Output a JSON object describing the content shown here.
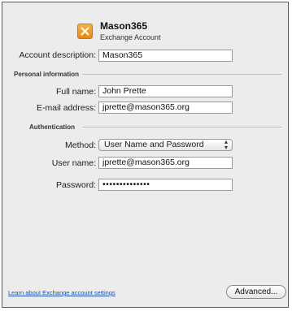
{
  "header": {
    "account_name": "Mason365",
    "account_type": "Exchange Account",
    "icon": "exchange-icon"
  },
  "account": {
    "description_label": "Account description:",
    "description_value": "Mason365"
  },
  "personal": {
    "section_label": "Personal information",
    "full_name_label": "Full name:",
    "full_name_value": "John Prette",
    "email_label": "E-mail address:",
    "email_value": "jprette@mason365.org"
  },
  "auth": {
    "section_label": "Authentication",
    "method_label": "Method:",
    "method_value": "User Name and Password",
    "username_label": "User name:",
    "username_value": "jprette@mason365.org",
    "password_label": "Password:",
    "password_value": "••••••••••••••"
  },
  "footer": {
    "learn_link": "Learn about Exchange account settings",
    "advanced_button": "Advanced..."
  }
}
